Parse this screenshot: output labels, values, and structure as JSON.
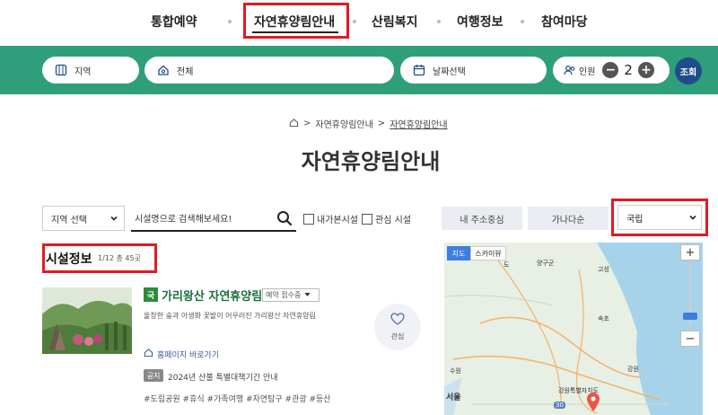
{
  "nav": {
    "items": [
      "통합예약",
      "자연휴양림안내",
      "산림복지",
      "여행정보",
      "참여마당"
    ],
    "active_index": 1
  },
  "search": {
    "region_label": "지역",
    "facility_label": "전체",
    "date_label": "날짜선택",
    "people_label": "인원",
    "people_count": "2",
    "minus": "−",
    "plus": "+",
    "lookup_label": "조회"
  },
  "breadcrumb": {
    "level1": "자연휴양림안내",
    "level2": "자연휴양림안내",
    "separator": ">"
  },
  "page_title": "자연휴양림안내",
  "filters": {
    "region_select": "지역 선택",
    "search_placeholder": "시설명으로 검색해보세요!",
    "visited_label": "내가본시설",
    "interest_label": "관심 시설",
    "sort_near": "내 주소중심",
    "sort_alpha": "가나다순",
    "type_select": "국립"
  },
  "facility_info": {
    "title": "시설정보",
    "count": "1/12 총 45곳"
  },
  "facility": {
    "badge": "국",
    "name": "가리왕산 자연휴양림",
    "reserve_status": "예약 접수중",
    "description": "울창한 숲과 아생화 꽃밭이 어우러진 가리왕산 자연휴양림",
    "homepage": "홈페이지 바로가기",
    "notice_badge": "공지",
    "notice_text": "2024년 산불 특별대책기간 안내",
    "tags": "#도립공원 #휴식 #가족여행 #자연탐구 #관광 #등산",
    "like_label": "관심",
    "thumb_caption": "가리왕산자연휴양림"
  },
  "map": {
    "tab_map": "지도",
    "tab_sky": "스카이뷰",
    "labels": {
      "yangu": "양구군",
      "goseong": "고성",
      "sokcho": "속초",
      "gangwon": "강원",
      "gangwon_do": "강원특별자치도",
      "seoul": "서울",
      "suwon": "수원",
      "area_do": "도",
      "num30": "30"
    }
  },
  "colors": {
    "brand_green": "#2f9e7b",
    "highlight_red": "#e01b24",
    "lookup_navy": "#1f4d8a",
    "facility_green": "#1d6f3a"
  }
}
